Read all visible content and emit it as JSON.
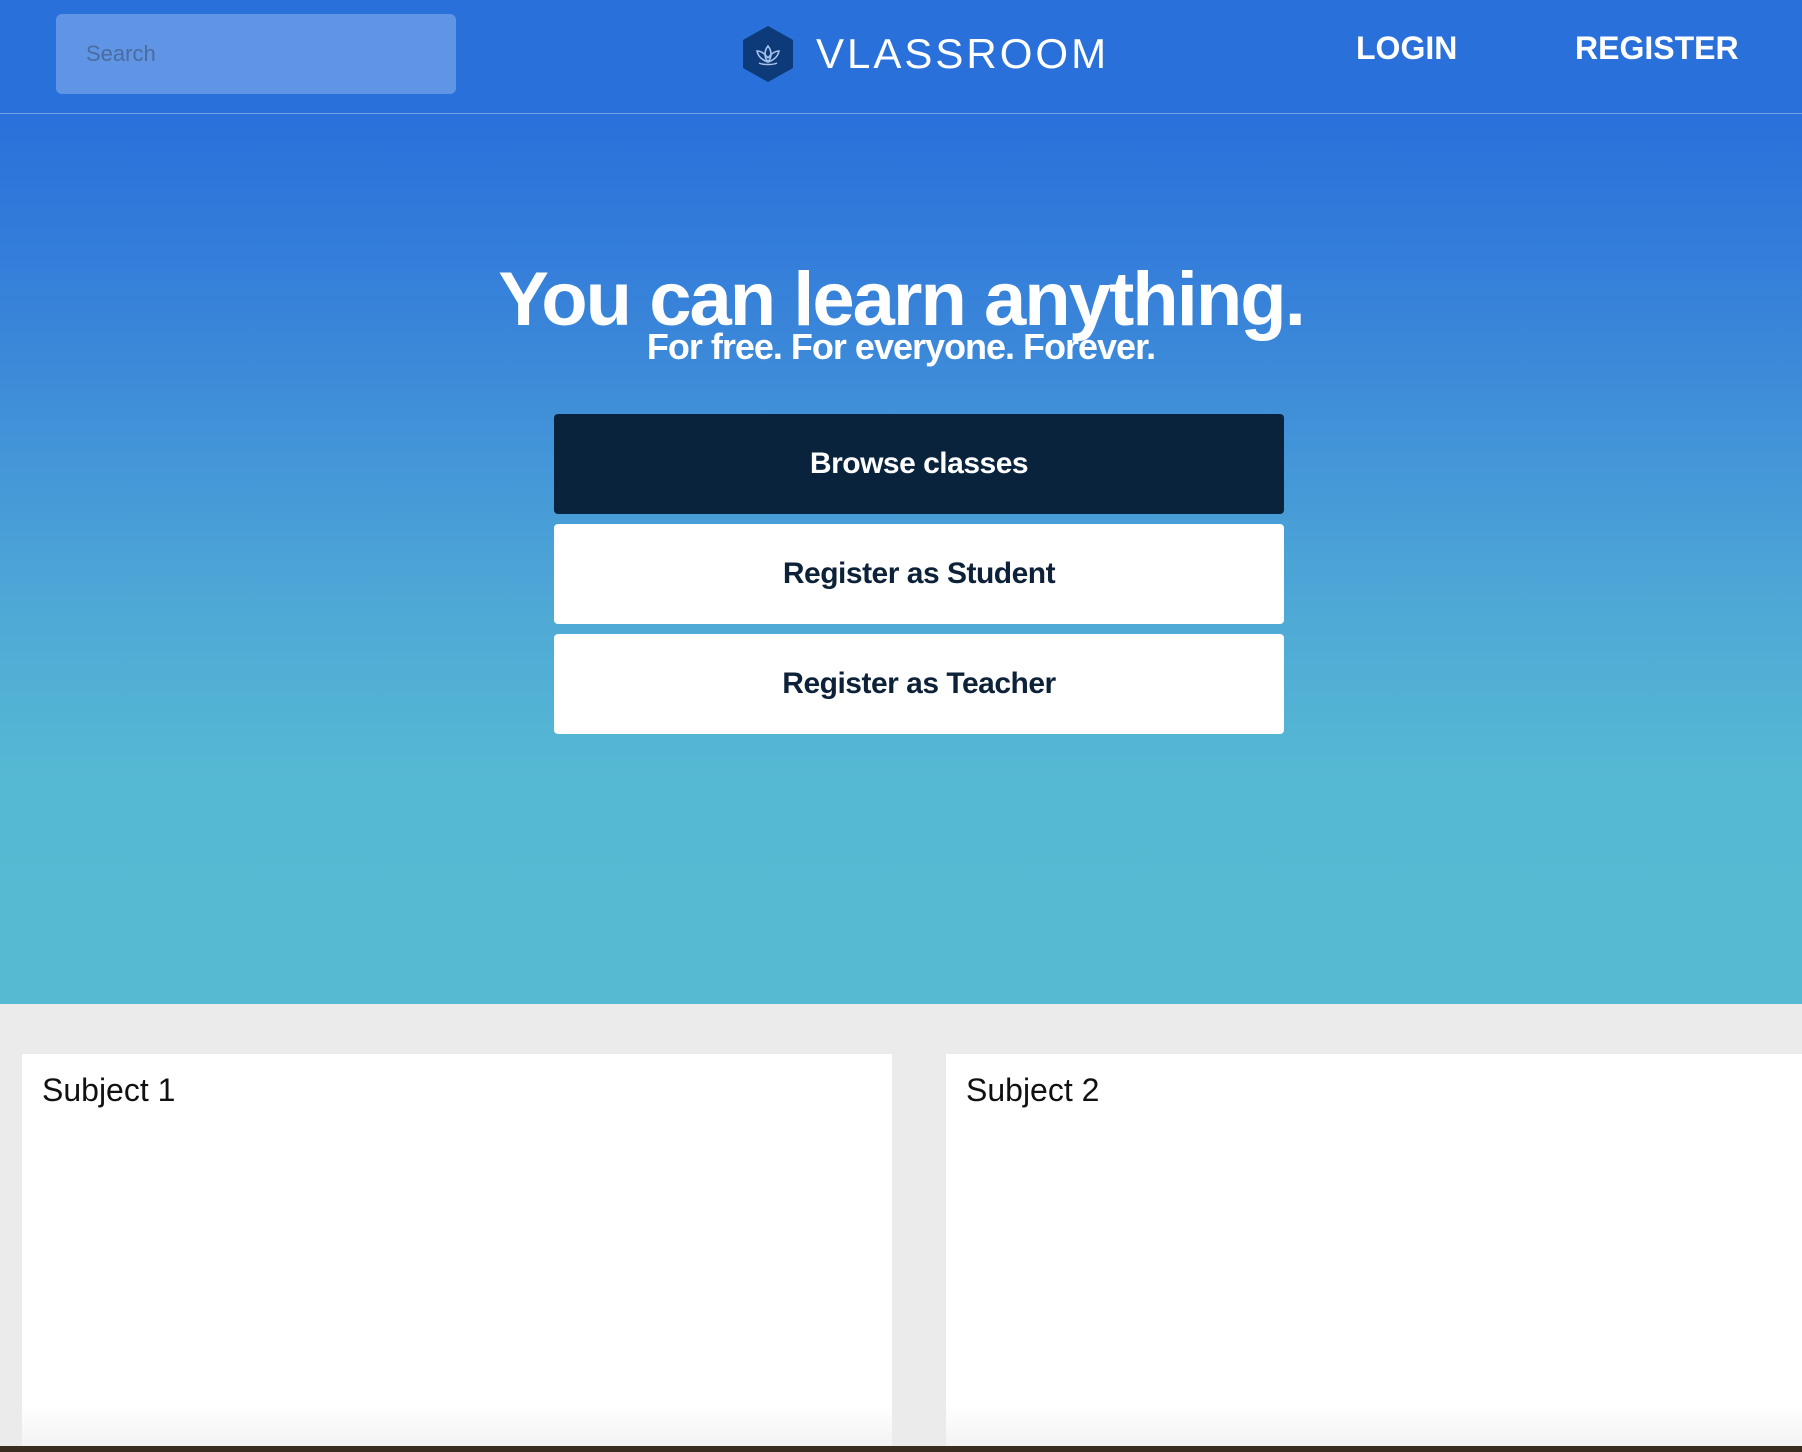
{
  "header": {
    "search_placeholder": "Search",
    "brand_name": "VLASSROOM",
    "brand_logo_icon": "lotus-hexagon-icon",
    "nav": {
      "login": "LOGIN",
      "register": "REGISTER"
    }
  },
  "hero": {
    "title": "You can learn anything.",
    "subtitle": "For free. For everyone. Forever.",
    "buttons": {
      "browse": "Browse classes",
      "register_student": "Register as Student",
      "register_teacher": "Register as Teacher"
    }
  },
  "subjects": [
    {
      "title": "Subject 1"
    },
    {
      "title": "Subject 2"
    }
  ],
  "colors": {
    "header_bg": "#2a70db",
    "hero_gradient_top": "#2a70db",
    "hero_gradient_bottom": "#57bad3",
    "primary_button": "#0a233d",
    "logo_hexagon": "#0d3a78"
  }
}
